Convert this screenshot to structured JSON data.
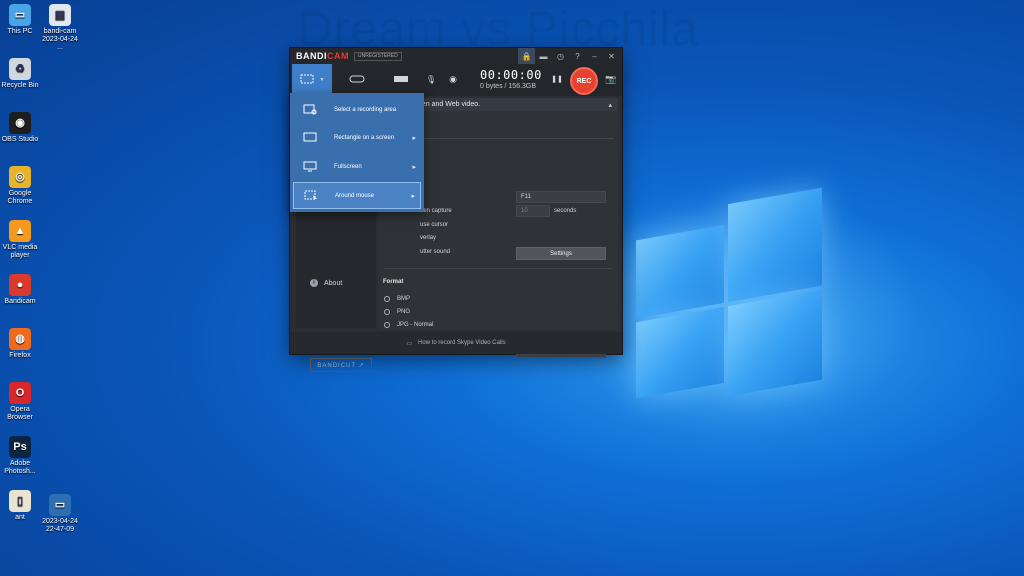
{
  "watermark": "Dream vs Picchila",
  "desktop_icons": [
    {
      "label": "This PC",
      "color": "#4aa3e6",
      "glyph": "▭"
    },
    {
      "label": "bandi-cam 2023-04-24 ...",
      "color": "#dfe8f0",
      "glyph": "▤"
    },
    {
      "label": "Recycle Bin",
      "color": "#cfd8e0",
      "glyph": "♻"
    },
    {
      "label": "OBS Studio",
      "color": "#1e1e1e",
      "glyph": "◉"
    },
    {
      "label": "Google Chrome",
      "color": "#e6b32b",
      "glyph": "◎"
    },
    {
      "label": "VLC media player",
      "color": "#f39a1e",
      "glyph": "▲"
    },
    {
      "label": "Bandicam",
      "color": "#d93a2b",
      "glyph": "●"
    },
    {
      "label": "Firefox",
      "color": "#f06a1e",
      "glyph": "◍"
    },
    {
      "label": "Opera Browser",
      "color": "#d8262b",
      "glyph": "O"
    },
    {
      "label": "Adobe Photosh...",
      "color": "#0b2540",
      "glyph": "Ps"
    },
    {
      "label": "ant",
      "color": "#e8e4d0",
      "glyph": "▯"
    },
    {
      "label": "2023-04-24 22-47-09",
      "color": "#2d6fb0",
      "glyph": "▭"
    }
  ],
  "app": {
    "logo_part1": "BANDI",
    "logo_part2": "CAM",
    "registered": "UNREGISTERED",
    "timer": "00:00:00",
    "size": "0 bytes / 156.3GB",
    "rec_label": "REC",
    "main_header": "een and Web video.",
    "hotkey_value": "F11",
    "capture_label": "een capture",
    "capture_seconds": "10",
    "seconds_label": "seconds",
    "cursor_label": "use cursor",
    "overlay_label": "verlay",
    "shutter_label": "utter sound",
    "settings_button": "Settings",
    "format_title": "Format",
    "formats": [
      {
        "label": "BMP",
        "checked": false
      },
      {
        "label": "PNG",
        "checked": false
      },
      {
        "label": "JPG - Normal",
        "checked": false
      },
      {
        "label": "JPG - High quality",
        "checked": true
      },
      {
        "label": "JPG - Custom quality (20~100)",
        "checked": false
      }
    ],
    "custom_quality_value": "90",
    "about_label": "About",
    "bandicut_label": "BANDICUT ↗",
    "footer_text": "How to record Skype Video Calls"
  },
  "dropdown": {
    "items": [
      {
        "label": "Select a recording area",
        "has_submenu": false
      },
      {
        "label": "Rectangle on a screen",
        "has_submenu": true
      },
      {
        "label": "Fullscreen",
        "has_submenu": true
      },
      {
        "label": "Around mouse",
        "has_submenu": true
      }
    ]
  },
  "colors": {
    "accent": "#3f7fc9",
    "rec": "#e8412f",
    "dropdown": "#3a6fae"
  }
}
